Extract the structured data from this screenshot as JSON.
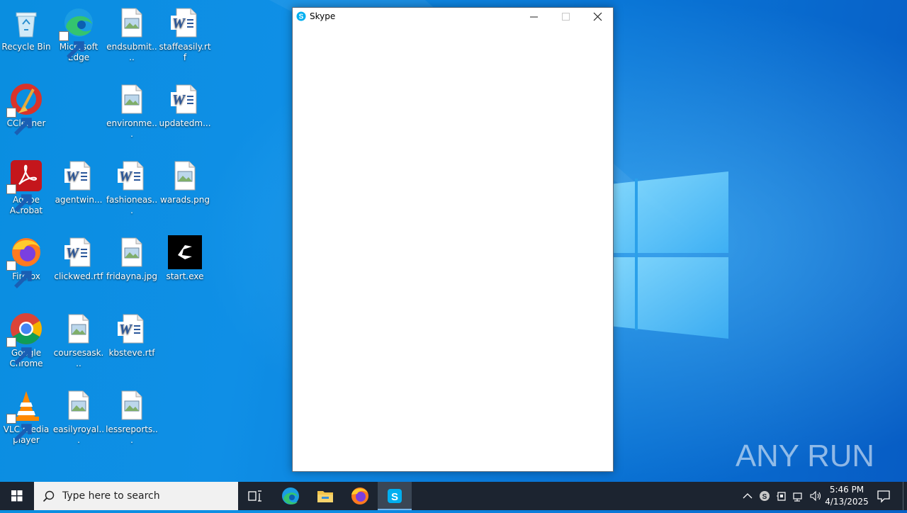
{
  "desktop": {
    "icons": [
      {
        "label": "Recycle Bin",
        "icon": "recycle-bin-icon"
      },
      {
        "label": "Microsoft Edge",
        "icon": "edge-icon"
      },
      {
        "label": "endsubmit....",
        "icon": "image-file-icon"
      },
      {
        "label": "staffeasily.rtf",
        "icon": "word-doc-icon"
      },
      {
        "label": "CCleaner",
        "icon": "ccleaner-icon"
      },
      {
        "label": "environme...",
        "icon": "image-file-icon"
      },
      {
        "label": "updatedm...",
        "icon": "word-doc-icon"
      },
      {
        "label": "Adobe Acrobat",
        "icon": "acrobat-icon"
      },
      {
        "label": "agentwin...",
        "icon": "word-doc-icon"
      },
      {
        "label": "fashioneas...",
        "icon": "word-doc-icon"
      },
      {
        "label": "warads.png",
        "icon": "image-file-icon"
      },
      {
        "label": "Firefox",
        "icon": "firefox-icon"
      },
      {
        "label": "clickwed.rtf",
        "icon": "word-doc-icon"
      },
      {
        "label": "fridayna.jpg",
        "icon": "image-file-icon"
      },
      {
        "label": "start.exe",
        "icon": "exe-icon"
      },
      {
        "label": "Google Chrome",
        "icon": "chrome-icon"
      },
      {
        "label": "coursesask...",
        "icon": "image-file-icon"
      },
      {
        "label": "kbsteve.rtf",
        "icon": "word-doc-icon"
      },
      {
        "label": "VLC media player",
        "icon": "vlc-icon"
      },
      {
        "label": "easilyroyal...",
        "icon": "image-file-icon"
      },
      {
        "label": "lessreports...",
        "icon": "image-file-icon"
      }
    ]
  },
  "window": {
    "title": "Skype",
    "buttons": {
      "minimize": "minimize-icon",
      "maximize": "maximize-icon",
      "close": "close-icon"
    }
  },
  "watermark": {
    "text": "ANY RUN"
  },
  "taskbar": {
    "search_placeholder": "Type here to search",
    "apps": [
      "task-view-icon",
      "edge-icon",
      "file-explorer-icon",
      "firefox-icon",
      "skype-icon"
    ],
    "active_app": "Skype",
    "time": "5:46 PM",
    "date": "4/13/2025"
  },
  "colors": {
    "accent": "#0078d7",
    "taskbar": "#1c2430",
    "skype": "#00aff0"
  }
}
